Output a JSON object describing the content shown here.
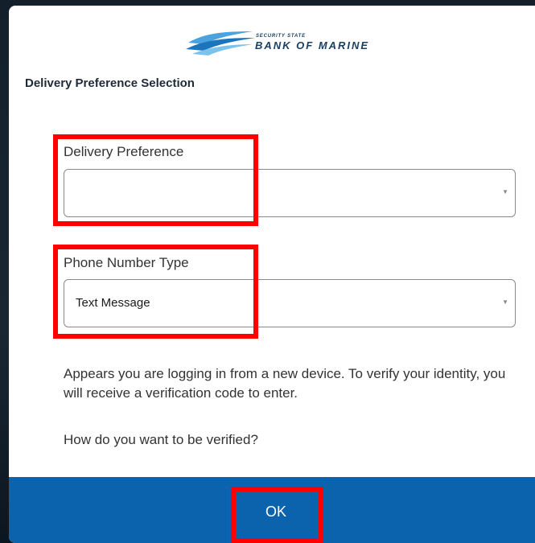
{
  "logo": {
    "small_text": "SECURITY STATE",
    "big_text": "BANK OF MARINE"
  },
  "dialog": {
    "title": "Delivery Preference Selection"
  },
  "delivery_preference": {
    "label": "Delivery Preference",
    "value": ""
  },
  "phone_number_type": {
    "label": "Phone Number Type",
    "value": "Text Message"
  },
  "info": {
    "message": "Appears you are logging in from a new device. To verify your identity, you will receive a verification code to enter.",
    "question": "How do you want to be verified?"
  },
  "footer": {
    "ok_label": "OK"
  },
  "colors": {
    "footer_bar": "#0b63ad",
    "highlight": "#ff0000",
    "brand": "#1b3f61"
  }
}
